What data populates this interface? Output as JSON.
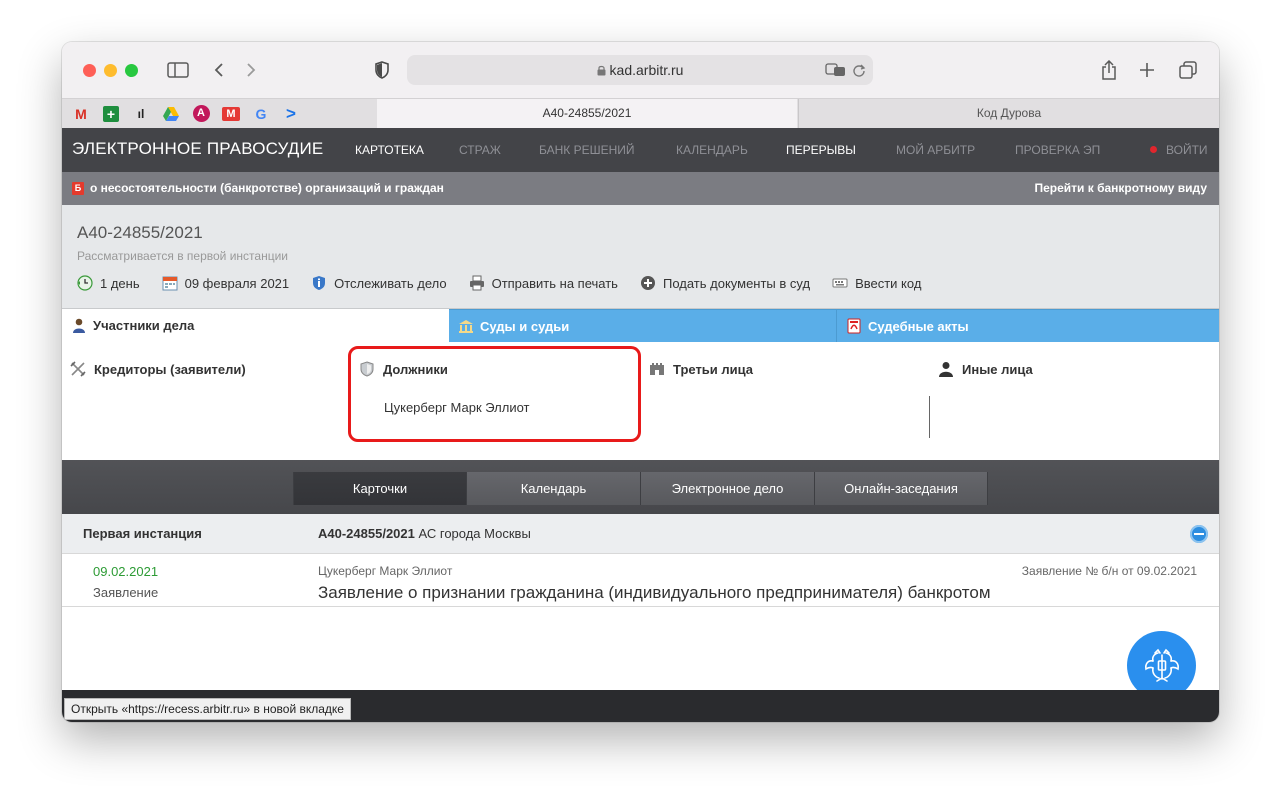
{
  "browser": {
    "url": "kad.arbitr.ru",
    "tabs": [
      {
        "label": "А40-24855/2021"
      },
      {
        "label": "Код Дурова"
      }
    ],
    "favorites": [
      "M",
      "+",
      "ıl",
      "▲",
      "A",
      "M",
      "G",
      ">"
    ],
    "status_tip": "Открыть «https://recess.arbitr.ru» в новой вкладке"
  },
  "site": {
    "brand": "ЭЛЕКТРОННОЕ ПРАВОСУДИЕ",
    "nav": [
      {
        "label": "КАРТОТЕКА"
      },
      {
        "label": "СТРАЖ"
      },
      {
        "label": "БАНК РЕШЕНИЙ"
      },
      {
        "label": "КАЛЕНДАРЬ"
      },
      {
        "label": "ПЕРЕРЫВЫ"
      },
      {
        "label": "МОЙ АРБИТР"
      },
      {
        "label": "ПРОВЕРКА ЭП"
      }
    ],
    "login": "ВОЙТИ",
    "sub_badge": "Б",
    "sub_left": "о несостоятельности (банкротстве) организаций и граждан",
    "sub_right": "Перейти к банкротному виду"
  },
  "case": {
    "number": "А40-24855/2021",
    "status": "Рассматривается в первой инстанции",
    "actions": [
      {
        "label": "1 день"
      },
      {
        "label": "09 февраля 2021"
      },
      {
        "label": "Отслеживать дело"
      },
      {
        "label": "Отправить на печать"
      },
      {
        "label": "Подать документы в суд"
      },
      {
        "label": "Ввести код"
      }
    ]
  },
  "participants_tabs": [
    {
      "label": "Участники дела"
    },
    {
      "label": "Суды и судьи"
    },
    {
      "label": "Судебные акты"
    }
  ],
  "participants": {
    "columns": [
      {
        "label": "Кредиторы (заявители)"
      },
      {
        "label": "Должники"
      },
      {
        "label": "Третьи лица"
      },
      {
        "label": "Иные лица"
      }
    ],
    "debtor": "Цукерберг Марк Эллиот"
  },
  "view_tabs": [
    {
      "label": "Карточки"
    },
    {
      "label": "Календарь"
    },
    {
      "label": "Электронное дело"
    },
    {
      "label": "Онлайн-заседания"
    }
  ],
  "instance": {
    "label": "Первая инстанция",
    "case_number": "А40-24855/2021",
    "court": " АС города Москвы"
  },
  "documents": [
    {
      "date": "09.02.2021",
      "type": "Заявление",
      "party": "Цукерберг Марк Эллиот",
      "title": "Заявление о признании гражданина (индивидуального предпринимателя) банкротом",
      "ref": "Заявление № б/н от 09.02.2021"
    }
  ],
  "colors": {
    "header_bg": "#434448",
    "accent_blue": "#5aaee8",
    "highlight_red": "#e81a1a",
    "date_green": "#2d9b35"
  }
}
